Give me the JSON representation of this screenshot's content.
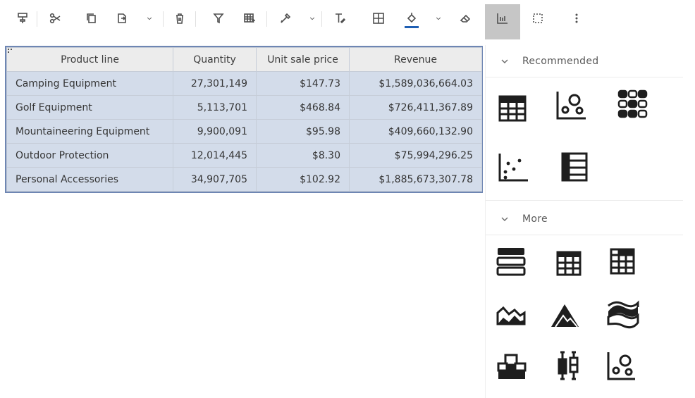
{
  "toolbar": {
    "items": [
      {
        "name": "paint-format",
        "icon": "paint-roller-icon"
      },
      {
        "name": "cut",
        "icon": "scissors-icon"
      },
      {
        "name": "copy",
        "icon": "copy-icon"
      },
      {
        "name": "paste",
        "icon": "paste-icon"
      },
      {
        "name": "delete",
        "icon": "trash-icon"
      },
      {
        "name": "filter",
        "icon": "filter-icon"
      },
      {
        "name": "summarize",
        "icon": "table-calc-icon"
      },
      {
        "name": "color-picker",
        "icon": "eyedropper-icon"
      },
      {
        "name": "text-format",
        "icon": "text-format-icon"
      },
      {
        "name": "borders",
        "icon": "grid-icon"
      },
      {
        "name": "fill-color",
        "icon": "paint-bucket-icon"
      },
      {
        "name": "eraser",
        "icon": "eraser-icon"
      },
      {
        "name": "visualizations",
        "icon": "bar-chart-icon",
        "active": true
      },
      {
        "name": "select",
        "icon": "dashed-box-icon"
      },
      {
        "name": "more",
        "icon": "overflow-menu-icon"
      }
    ],
    "fill_color_swatch": "#1f5fb3"
  },
  "table": {
    "headers": [
      "Product line",
      "Quantity",
      "Unit sale price",
      "Revenue"
    ],
    "rows": [
      {
        "product_line": "Camping Equipment",
        "quantity": "27,301,149",
        "unit_sale_price": "$147.73",
        "revenue": "$1,589,036,664.03"
      },
      {
        "product_line": "Golf Equipment",
        "quantity": "5,113,701",
        "unit_sale_price": "$468.84",
        "revenue": "$726,411,367.89"
      },
      {
        "product_line": "Mountaineering Equipment",
        "quantity": "9,900,091",
        "unit_sale_price": "$95.98",
        "revenue": "$409,660,132.90"
      },
      {
        "product_line": "Outdoor Protection",
        "quantity": "12,014,445",
        "unit_sale_price": "$8.30",
        "revenue": "$75,994,296.25"
      },
      {
        "product_line": "Personal Accessories",
        "quantity": "34,907,705",
        "unit_sale_price": "$102.92",
        "revenue": "$1,885,673,307.78"
      }
    ],
    "selection_color": "#d3dcea",
    "selection_border": "#6e86b3"
  },
  "panel": {
    "recommended": {
      "label": "Recommended",
      "icons": [
        "crosstab-icon",
        "bubble-chart-icon",
        "heatmap-icon",
        "scatter-plot-icon",
        "list-table-icon"
      ]
    },
    "more": {
      "label": "More",
      "icons": [
        "list-icon",
        "grid-table-icon",
        "crosstab-icon",
        "area-chart-icon",
        "mountain-chart-icon",
        "stream-chart-icon",
        "waterfall-icon",
        "boxplot-icon",
        "bubble-chart-icon"
      ]
    }
  }
}
